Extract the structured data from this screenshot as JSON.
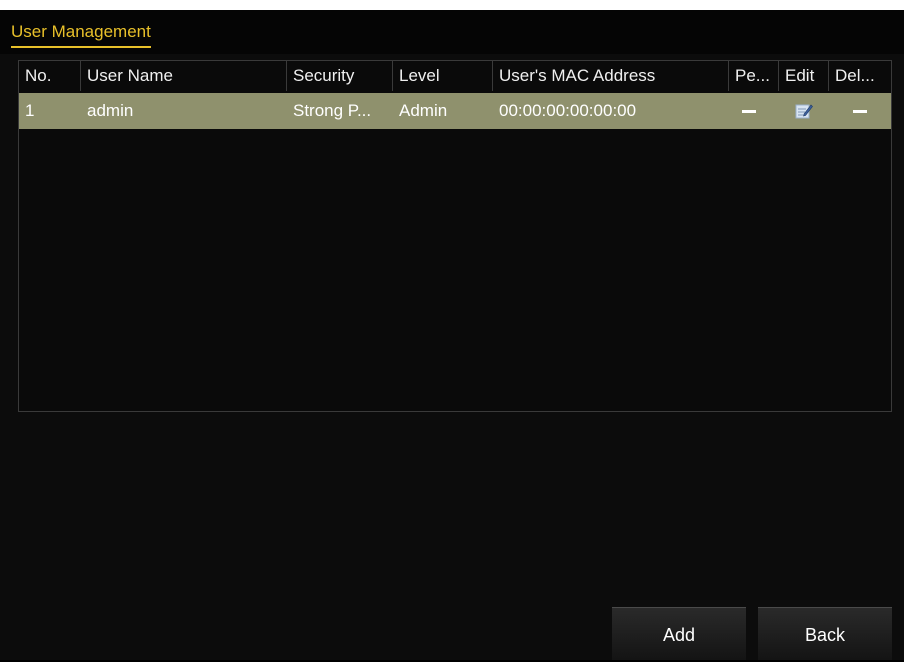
{
  "window": {
    "title": "User Management"
  },
  "table": {
    "columns": [
      "No.",
      "User Name",
      "Security",
      "Level",
      "User's MAC Address",
      "Pe...",
      "Edit",
      "Del..."
    ],
    "rows": [
      {
        "no": "1",
        "user_name": "admin",
        "security": "Strong P...",
        "level": "Admin",
        "mac": "00:00:00:00:00:00",
        "permission_icon": "dash-icon",
        "edit_icon": "edit-icon",
        "delete_icon": "dash-icon"
      }
    ]
  },
  "buttons": {
    "add": "Add",
    "back": "Back"
  },
  "colors": {
    "accent": "#e8c02a",
    "selected_row": "#8f916d",
    "background": "#0c0c0c"
  }
}
